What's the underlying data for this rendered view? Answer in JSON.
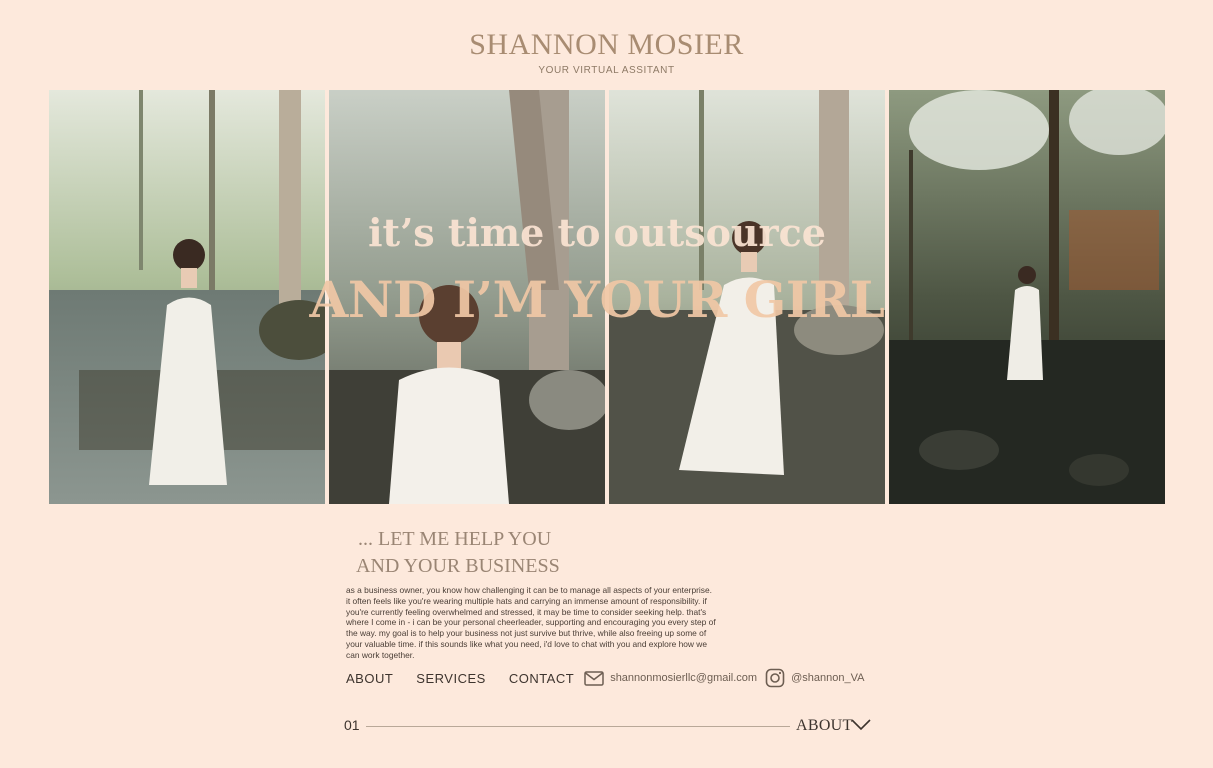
{
  "brand": {
    "name": "SHANNON MOSIER",
    "tagline": "YOUR VIRTUAL ASSITANT"
  },
  "hero": {
    "line1": "it’s time to outsource",
    "line2": "AND I’M YOUR GIRL"
  },
  "intro": {
    "heading_line1": "... LET ME HELP YOU",
    "heading_line2": "AND YOUR BUSINESS",
    "body": "as a business owner, you know how challenging it can be to manage all aspects of your enterprise. it often feels like you're wearing multiple hats and carrying an immense amount of responsibility. if you're currently feeling overwhelmed and stressed, it may be time to consider seeking help. that's where I come in - i can be your personal cheerleader, supporting and encouraging you every step of the way. my goal is to help your business not just survive but thrive, while also freeing up some of your valuable time. if this sounds like what you need, i'd love to chat with you and explore how we can work together."
  },
  "nav": {
    "about": "ABOUT",
    "services": "SERVICES",
    "contact": "CONTACT",
    "email": "shannonmosierllc@gmail.com",
    "instagram": "@shannon_VA",
    "email_icon": "mail-icon",
    "instagram_icon": "instagram-icon"
  },
  "footer": {
    "page_number": "01",
    "section_label": "ABOUT",
    "chevron_icon": "chevron-down-icon"
  },
  "colors": {
    "background": "#fde9dc",
    "brand": "#a88c72",
    "hero_light": "#fbe4d3",
    "hero_accent": "#f1c8a6",
    "text": "#3d342e"
  }
}
